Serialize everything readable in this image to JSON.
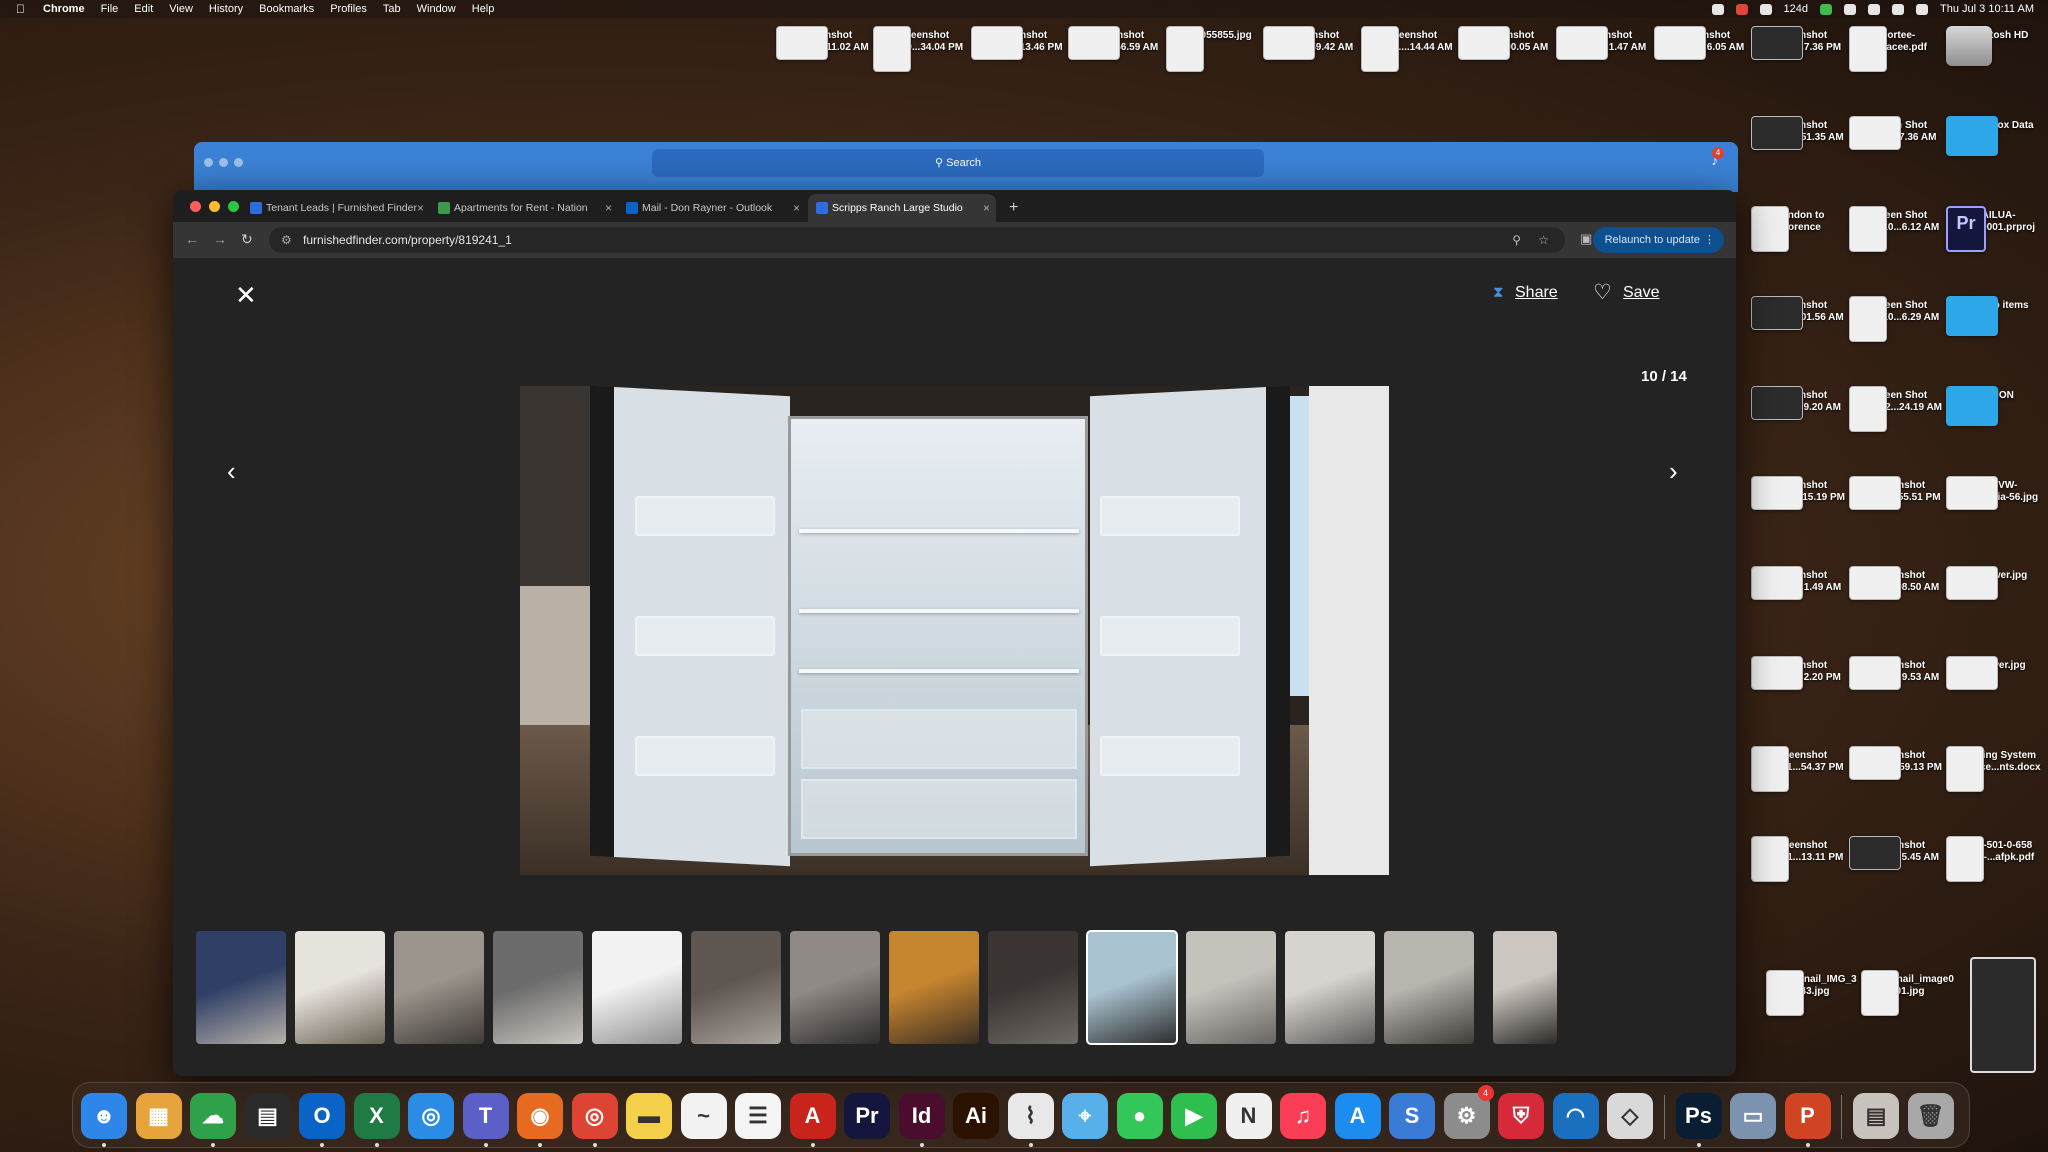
{
  "menubar": {
    "apple": "",
    "items": [
      "Chrome",
      "File",
      "Edit",
      "View",
      "History",
      "Bookmarks",
      "Profiles",
      "Tab",
      "Window",
      "Help"
    ],
    "temperature": "124d",
    "clock": "Thu Jul 3  10:11 AM"
  },
  "desktop_icons": [
    {
      "label": "Screenshot\n2025-07...11.02 AM",
      "type": "screenshot"
    },
    {
      "label": "Screenshot\n2025-0...34.04 PM",
      "type": "doc"
    },
    {
      "label": "Screenshot\n2025-0....13.46 PM",
      "type": "screenshot"
    },
    {
      "label": "Screenshot\n2025-0...56.59 AM",
      "type": "screenshot"
    },
    {
      "label": "1000055855.jpg",
      "type": "doc"
    },
    {
      "label": "Screenshot\n2025-0...59.42 AM",
      "type": "screenshot"
    },
    {
      "label": "Screenshot\n2025-0....14.44 AM",
      "type": "doc"
    },
    {
      "label": "Screenshot\n2025-0...00.05 AM",
      "type": "screenshot"
    },
    {
      "label": "Screenshot\n2025-01...1.47 AM",
      "type": "screenshot"
    },
    {
      "label": "Screenshot\n2024-12...6.05 AM",
      "type": "screenshot"
    },
    {
      "label": "Screenshot\n2024-10...7.36 PM",
      "type": "dark"
    },
    {
      "label": "Portee-\nespacee.pdf",
      "type": "doc"
    },
    {
      "label": "Macintosh HD",
      "type": "disk"
    },
    {
      "label": "Screenshot\n2024-11...51.35 AM",
      "type": "dark"
    },
    {
      "label": "Screen Shot\n2021-0...7.36 AM",
      "type": "screenshot"
    },
    {
      "label": "Old Firefox Data",
      "type": "folder"
    },
    {
      "label": "London to\nFlorence",
      "type": "doc"
    },
    {
      "label": "Screen Shot\n2021-10...6.12 AM",
      "type": "doc"
    },
    {
      "label": "KAILUA-\nchip_0001.prproj",
      "type": "pr"
    },
    {
      "label": "Screenshot\n2024-11...01.56 AM",
      "type": "dark"
    },
    {
      "label": "Screen Shot\n2021-10...6.29 AM",
      "type": "doc"
    },
    {
      "label": "desktop items",
      "type": "folder"
    },
    {
      "label": "Screenshot\n2024-11...9.20 AM",
      "type": "dark"
    },
    {
      "label": "Screen Shot\n2021-12...24.19 AM",
      "type": "doc"
    },
    {
      "label": "FUSION",
      "type": "folder"
    },
    {
      "label": "Screenshot\n2024-11....15.19 PM",
      "type": "screenshot"
    },
    {
      "label": "Screenshot\n2024-0....55.51 PM",
      "type": "screenshot"
    },
    {
      "label": "1974-VW-\nKarman...ia-56.jpg",
      "type": "screenshot"
    },
    {
      "label": "Screenshot\n2024-12...1.49 AM",
      "type": "screenshot"
    },
    {
      "label": "Screenshot\n2024-0...08.50 AM",
      "type": "screenshot"
    },
    {
      "label": "sol-power.jpg",
      "type": "screenshot"
    },
    {
      "label": "Screenshot\n2024-11...2.20 PM",
      "type": "screenshot"
    },
    {
      "label": "Screenshot\n2024-10...9.53 AM",
      "type": "screenshot"
    },
    {
      "label": "solpower.jpg",
      "type": "screenshot"
    },
    {
      "label": "Screenshot\n2024-11...54.37 PM",
      "type": "doc"
    },
    {
      "label": "Screenshot\n2024-10...59.13 PM",
      "type": "screenshot"
    },
    {
      "label": "Ticketing System\nEnhance...nts.docx",
      "type": "doc"
    },
    {
      "label": "Screenshot\n2024-11...13.11 PM",
      "type": "doc"
    },
    {
      "label": "Screenshot\n2024-11...5.45 AM",
      "type": "dark"
    },
    {
      "label": "all-34-501-0-658\n69902-...afpk.pdf",
      "type": "doc"
    },
    {
      "label": "thumbnail_IMG_3\n43.jpg",
      "type": "doc"
    },
    {
      "label": "thumbnail_image0\n01.jpg",
      "type": "doc"
    }
  ],
  "bg_window": {
    "search_label": "Search",
    "badge": "4"
  },
  "browser": {
    "tabs": [
      {
        "label": "Tenant Leads | Furnished Finder",
        "favicon_color": "#2d6cdf",
        "active": false
      },
      {
        "label": "Apartments for Rent - Nation",
        "favicon_color": "#3c9a4a",
        "active": false
      },
      {
        "label": "Mail - Don Rayner - Outlook",
        "favicon_color": "#0a64c8",
        "active": false
      },
      {
        "label": "Scripps Ranch Large Studio",
        "favicon_color": "#2d6cdf",
        "active": true
      }
    ],
    "new_tab": "+",
    "url": "furnishedfinder.com/property/819241_1",
    "relaunch_label": "Relaunch to update"
  },
  "gallery": {
    "close": "✕",
    "share_label": "Share",
    "save_label": "Save",
    "counter": "10 / 14",
    "prev": "‹",
    "next": "›",
    "thumbnails": [
      {
        "name": "thumb-bedroom",
        "colors": [
          "#2f3f66",
          "#b7b0a8"
        ]
      },
      {
        "name": "thumb-living-room",
        "colors": [
          "#e6e2dc",
          "#6b6356"
        ]
      },
      {
        "name": "thumb-kitchen",
        "colors": [
          "#9c958d",
          "#3e3a36"
        ]
      },
      {
        "name": "thumb-kitchen-appliances",
        "colors": [
          "#6c6c6c",
          "#c9c5bf"
        ]
      },
      {
        "name": "thumb-cabinet-dishes",
        "colors": [
          "#f2f2f2",
          "#8e8e8e"
        ]
      },
      {
        "name": "thumb-pots-pans",
        "colors": [
          "#5e5650",
          "#a8a29c"
        ]
      },
      {
        "name": "thumb-utensils-drawer",
        "colors": [
          "#908a86",
          "#2f2c2a"
        ]
      },
      {
        "name": "thumb-knife-drawer",
        "colors": [
          "#c6852f",
          "#3b2e22"
        ]
      },
      {
        "name": "thumb-closet",
        "colors": [
          "#3a3532",
          "#6e6a66"
        ]
      },
      {
        "name": "thumb-refrigerator",
        "colors": [
          "#a9c3d1",
          "#2c2c2c"
        ],
        "selected": true
      },
      {
        "name": "thumb-shower",
        "colors": [
          "#c5c2bc",
          "#676461"
        ]
      },
      {
        "name": "thumb-bathroom-vanity",
        "colors": [
          "#d7d3ce",
          "#5c5a58"
        ]
      },
      {
        "name": "thumb-storage",
        "colors": [
          "#b8b4ae",
          "#403c38"
        ]
      },
      {
        "name": "thumb-door-lock",
        "colors": [
          "#cbc6bf",
          "#2d2a28"
        ]
      }
    ]
  },
  "dock": {
    "apps": [
      {
        "name": "finder",
        "glyph": "☻",
        "color": "#2f86e9",
        "dot": true
      },
      {
        "name": "launchpad",
        "glyph": "▦",
        "color": "#e7a33c",
        "dot": false
      },
      {
        "name": "network-radar",
        "glyph": "☁",
        "color": "#2fa14a",
        "dot": true
      },
      {
        "name": "calculator",
        "glyph": "▤",
        "color": "#2a2a2a",
        "dot": false
      },
      {
        "name": "outlook",
        "glyph": "O",
        "color": "#0a64c8",
        "dot": true
      },
      {
        "name": "excel",
        "glyph": "X",
        "color": "#1f7a43",
        "dot": true
      },
      {
        "name": "safari",
        "glyph": "◎",
        "color": "#2b8ce6",
        "dot": false
      },
      {
        "name": "teams",
        "glyph": "T",
        "color": "#5b5fc7",
        "dot": true
      },
      {
        "name": "firefox",
        "glyph": "◉",
        "color": "#e66a1f",
        "dot": true
      },
      {
        "name": "chrome",
        "glyph": "◎",
        "color": "#dd4433",
        "dot": true
      },
      {
        "name": "notes",
        "glyph": "▬",
        "color": "#f5d04a",
        "dot": false
      },
      {
        "name": "freeform",
        "glyph": "~",
        "color": "#f2f2f2",
        "dot": false
      },
      {
        "name": "reminders",
        "glyph": "☰",
        "color": "#f5f5f5",
        "dot": false
      },
      {
        "name": "acrobat",
        "glyph": "A",
        "color": "#c8241c",
        "dot": true
      },
      {
        "name": "premiere-pro",
        "glyph": "Pr",
        "color": "#14163d",
        "dot": false
      },
      {
        "name": "indesign",
        "glyph": "Id",
        "color": "#4a0d2e",
        "dot": true
      },
      {
        "name": "illustrator",
        "glyph": "Ai",
        "color": "#2b1200",
        "dot": false
      },
      {
        "name": "activity-monitor",
        "glyph": "⌇",
        "color": "#e8e8e8",
        "dot": true
      },
      {
        "name": "maps",
        "glyph": "⌖",
        "color": "#58b0ea",
        "dot": false
      },
      {
        "name": "messages",
        "glyph": "●",
        "color": "#33c75a",
        "dot": false
      },
      {
        "name": "facetime",
        "glyph": "▶",
        "color": "#2fbf4f",
        "dot": false
      },
      {
        "name": "news",
        "glyph": "N",
        "color": "#f0f0f0",
        "dot": false
      },
      {
        "name": "music",
        "glyph": "♫",
        "color": "#fa3e55",
        "dot": false
      },
      {
        "name": "app-store",
        "glyph": "A",
        "color": "#1d8cf0",
        "dot": false
      },
      {
        "name": "setapp",
        "glyph": "S",
        "color": "#3a7bd5",
        "dot": false
      },
      {
        "name": "system-settings",
        "glyph": "⚙",
        "color": "#8c8c8c",
        "dot": false,
        "badge": "4"
      },
      {
        "name": "security-app",
        "glyph": "⛨",
        "color": "#d62a3a",
        "dot": false
      },
      {
        "name": "browser-swirl",
        "glyph": "◠",
        "color": "#1b6fbf",
        "dot": false
      },
      {
        "name": "preview-shape",
        "glyph": "◇",
        "color": "#d9d9d9",
        "dot": false
      },
      {
        "name": "photoshop",
        "glyph": "Ps",
        "color": "#0a1e33",
        "dot": true
      },
      {
        "name": "screens-app",
        "glyph": "▭",
        "color": "#7c93b0",
        "dot": false
      },
      {
        "name": "powerpoint",
        "glyph": "P",
        "color": "#d04423",
        "dot": true
      },
      {
        "name": "downloads-stack",
        "glyph": "▤",
        "color": "#c8c3bd",
        "dot": false
      },
      {
        "name": "trash",
        "glyph": "🗑",
        "color": "#a8a8a8",
        "dot": false
      }
    ]
  }
}
